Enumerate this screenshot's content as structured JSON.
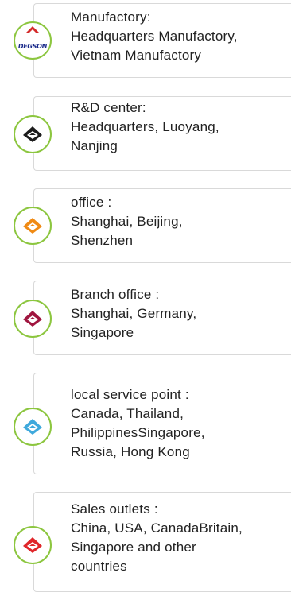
{
  "items": [
    {
      "title": "Manufactory:",
      "lines": [
        "Headquarters Manufactory,",
        "Vietnam Manufactory"
      ],
      "icon": "degson-logo-icon",
      "logo_text": "DEGSON",
      "color": "#d42a2a"
    },
    {
      "title": "R&D center:",
      "lines": [
        "Headquarters, Luoyang,",
        "Nanjing"
      ],
      "icon": "black-diamond-icon",
      "color": "#1c1c1c"
    },
    {
      "title": "office :",
      "lines": [
        "Shanghai, Beijing,",
        "Shenzhen"
      ],
      "icon": "orange-diamond-icon",
      "color": "#f08a14"
    },
    {
      "title": "Branch office :",
      "lines": [
        "Shanghai, Germany,",
        "Singapore"
      ],
      "icon": "crimson-diamond-icon",
      "color": "#a0163f"
    },
    {
      "title": "local service point  :",
      "lines": [
        "Canada, Thailand,",
        "PhilippinesSingapore,",
        "Russia, Hong Kong"
      ],
      "icon": "blue-diamond-icon",
      "color": "#3fa9dc"
    },
    {
      "title": "Sales outlets :",
      "lines": [
        "China, USA, CanadaBritain,",
        "Singapore and other",
        "countries"
      ],
      "icon": "red-diamond-icon",
      "color": "#e0262a"
    }
  ]
}
